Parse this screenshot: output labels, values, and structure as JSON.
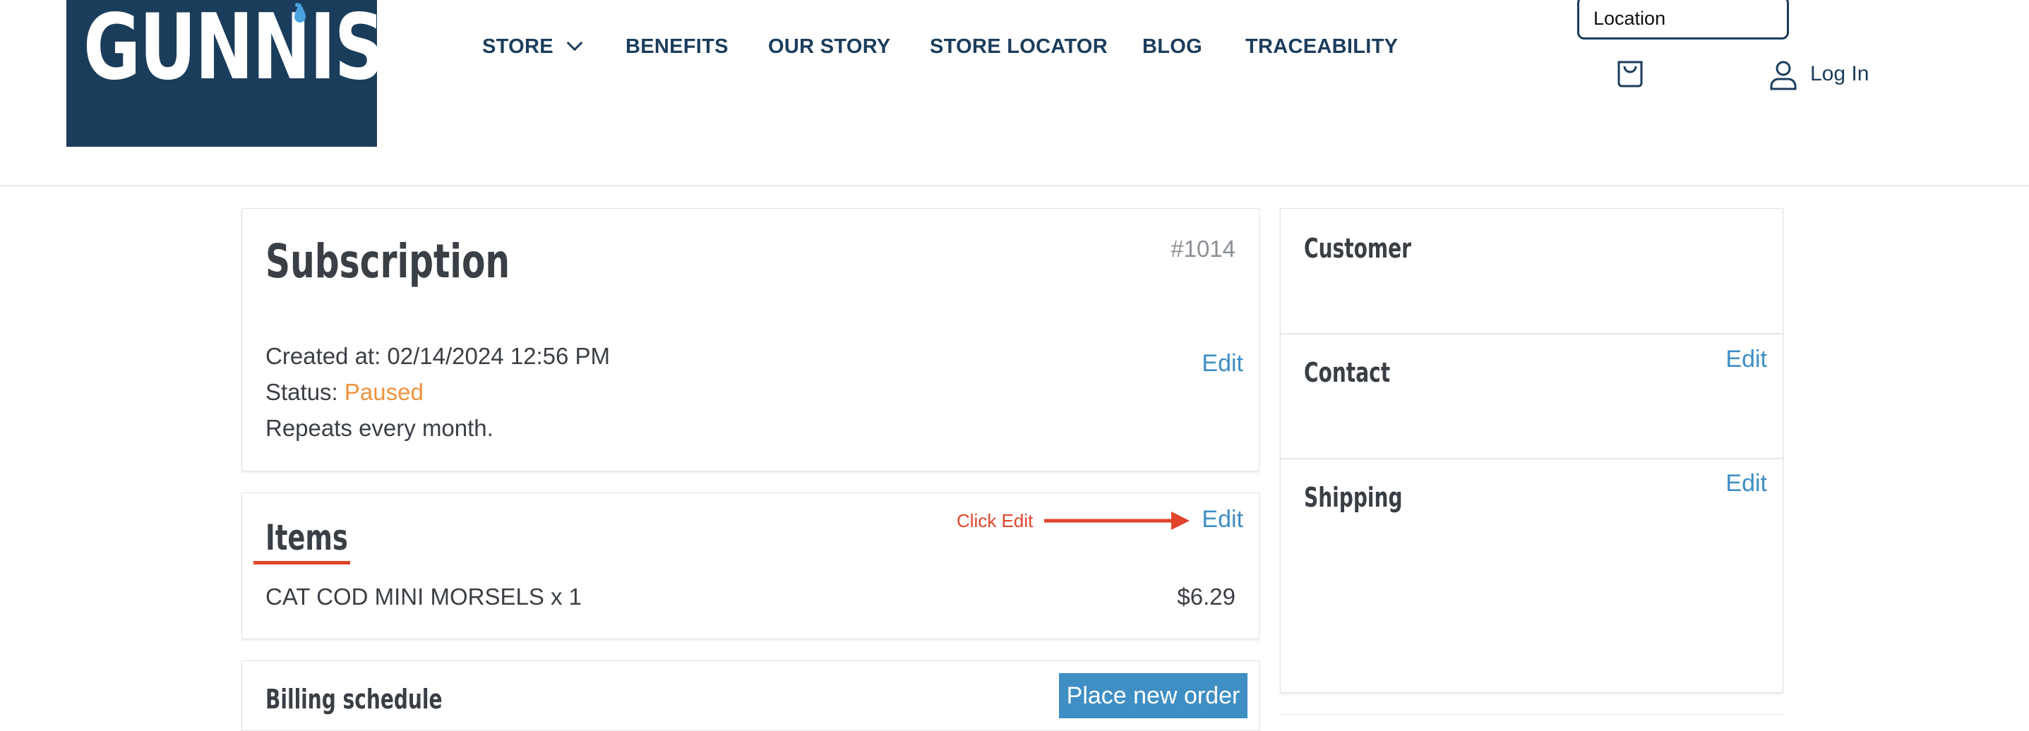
{
  "brand": {
    "name": "GUNNIS",
    "reg": "®"
  },
  "nav": {
    "items": [
      {
        "label": "STORE"
      },
      {
        "label": "BENEFITS"
      },
      {
        "label": "OUR STORY"
      },
      {
        "label": "STORE LOCATOR"
      },
      {
        "label": "BLOG"
      },
      {
        "label": "TRACEABILITY"
      }
    ]
  },
  "header": {
    "location_value": "Location",
    "login_label": "Log In"
  },
  "subscription": {
    "title": "Subscription",
    "number": "#1014",
    "created": "Created at: 02/14/2024 12:56 PM",
    "status_label": "Status:",
    "status_value": "Paused",
    "status_color": "#f0923c",
    "repeats": "Repeats every month.",
    "edit_label": "Edit"
  },
  "items": {
    "title": "Items",
    "annotation": "Click Edit",
    "annotation_color": "#e0442b",
    "edit_label": "Edit",
    "rows": [
      {
        "name": "CAT COD MINI MORSELS x 1",
        "price": "$6.29"
      }
    ]
  },
  "billing": {
    "title": "Billing schedule",
    "button_label": "Place new order"
  },
  "sidebar": {
    "customer_title": "Customer",
    "contact_title": "Contact",
    "contact_edit": "Edit",
    "shipping_title": "Shipping",
    "shipping_edit": "Edit"
  },
  "colors": {
    "brand_navy": "#1b3d5c",
    "link_blue": "#3f8ec4"
  }
}
